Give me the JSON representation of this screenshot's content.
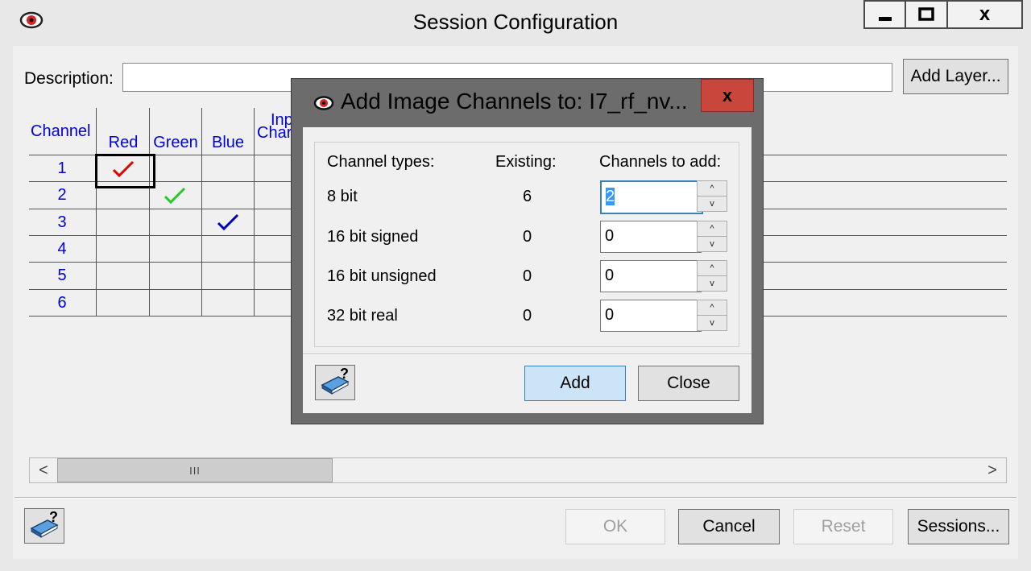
{
  "window": {
    "title": "Session Configuration",
    "close_glyph": "x"
  },
  "description": {
    "label": "Description:",
    "value": ""
  },
  "add_layer_button": "Add Layer...",
  "grid": {
    "headers": {
      "channel": "Channel",
      "red": "Red",
      "green": "Green",
      "blue": "Blue",
      "input_channel_line1": "Inp",
      "input_channel_line2": "Char"
    },
    "rows": [
      "1",
      "2",
      "3",
      "4",
      "5",
      "6"
    ],
    "checks": [
      {
        "row": "1",
        "column": "Red",
        "color": "#e00000"
      },
      {
        "row": "2",
        "column": "Green",
        "color": "#22cc22"
      },
      {
        "row": "3",
        "column": "Blue",
        "color": "#0000c0"
      }
    ],
    "selected_cell": {
      "row": "1",
      "column": "Red"
    }
  },
  "scrollbar": {
    "left": "<",
    "thumb": "III",
    "right": ">"
  },
  "footer": {
    "ok": "OK",
    "cancel": "Cancel",
    "reset": "Reset",
    "sessions": "Sessions..."
  },
  "dialog": {
    "title": "Add Image Channels to: I7_rf_nv...",
    "close_glyph": "x",
    "headers": {
      "types": "Channel types:",
      "existing": "Existing:",
      "to_add": "Channels to add:"
    },
    "rows": [
      {
        "type": "8 bit",
        "existing": "6",
        "to_add": "2"
      },
      {
        "type": "16 bit signed",
        "existing": "0",
        "to_add": "0"
      },
      {
        "type": "16 bit unsigned",
        "existing": "0",
        "to_add": "0"
      },
      {
        "type": "32 bit real",
        "existing": "0",
        "to_add": "0"
      }
    ],
    "add": "Add",
    "close": "Close"
  },
  "icons": {
    "app": "eye-icon",
    "help": "help-book-icon",
    "minimize": "minimize-icon",
    "maximize": "maximize-icon",
    "close": "close-icon"
  }
}
